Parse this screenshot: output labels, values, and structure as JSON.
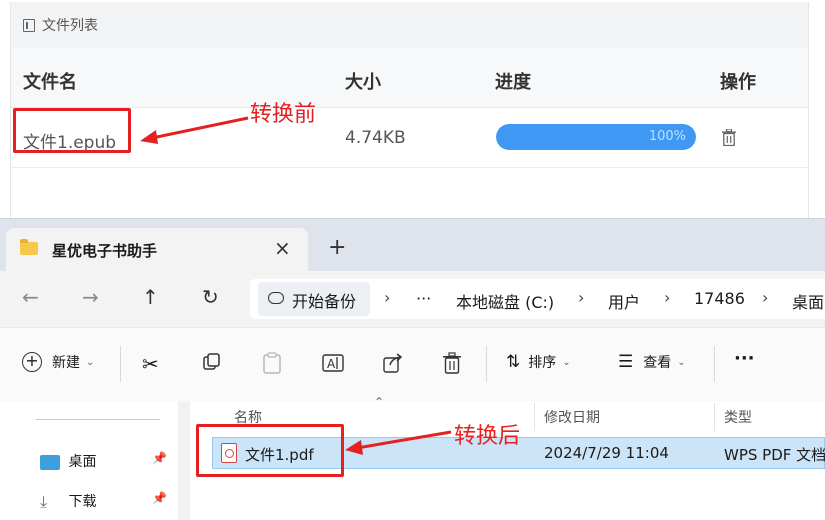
{
  "file_list_panel": {
    "title": "文件列表",
    "columns": {
      "name": "文件名",
      "size": "大小",
      "progress": "进度",
      "action": "操作"
    },
    "rows": [
      {
        "name": "文件1.epub",
        "size": "4.74KB",
        "progress": 1.0,
        "progress_label": "100%"
      }
    ]
  },
  "annotations": {
    "before": "转换前",
    "after": "转换后",
    "color": "#e52020"
  },
  "explorer": {
    "tab_title": "星优电子书助手",
    "address_bar": {
      "pill_label": "开始备份",
      "ellipsis": "···",
      "breadcrumbs": [
        "本地磁盘 (C:)",
        "用户",
        "17486",
        "桌面"
      ]
    },
    "toolbar": {
      "new_label": "新建",
      "sort_label": "排序",
      "view_label": "查看",
      "more_label": "···"
    },
    "sidebar": {
      "items": [
        {
          "label": "桌面",
          "icon": "desktop-icon"
        },
        {
          "label": "下载",
          "icon": "download-icon"
        }
      ]
    },
    "file_list": {
      "columns": {
        "name": "名称",
        "modified": "修改日期",
        "type": "类型"
      },
      "rows": [
        {
          "name": "文件1.pdf",
          "modified": "2024/7/29 11:04",
          "type": "WPS PDF 文档"
        }
      ]
    }
  },
  "colors": {
    "progress_fill": "#3f98f3",
    "selection": "#cce4f7"
  }
}
